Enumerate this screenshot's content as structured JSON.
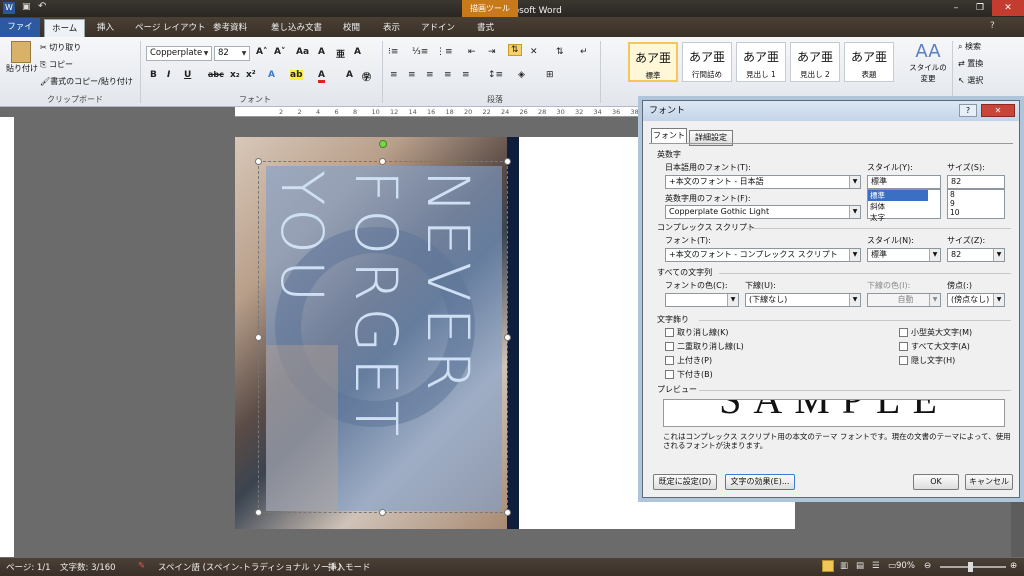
{
  "window": {
    "title": "文書1 - Microsoft Word",
    "context_tab": "描画ツール"
  },
  "tabs": [
    "ファイル",
    "ホーム",
    "挿入",
    "ページ レイアウト",
    "参考資料",
    "差し込み文書",
    "校閲",
    "表示",
    "アドイン",
    "書式"
  ],
  "clipboard": {
    "paste": "貼り付け",
    "cut": "切り取り",
    "copy": "コピー",
    "format_painter": "書式のコピー/貼り付け",
    "label": "クリップボード"
  },
  "font": {
    "name": "Copperplate",
    "size": "82",
    "label": "フォント"
  },
  "paragraph": {
    "label": "段落"
  },
  "styles": {
    "label": "スタイル",
    "items": [
      {
        "sample": "あア亜",
        "name": "標準"
      },
      {
        "sample": "あア亜",
        "name": "行間詰め"
      },
      {
        "sample": "あア亜",
        "name": "見出し 1"
      },
      {
        "sample": "あア亜",
        "name": "見出し 2"
      },
      {
        "sample": "あア亜",
        "name": "表題"
      }
    ],
    "change": "スタイルの変更",
    "editing_label": "編集",
    "search": "検索",
    "replace": "置換",
    "select": "選択"
  },
  "ruler": [
    "2",
    "2",
    "4",
    "6",
    "8",
    "10",
    "12",
    "14",
    "16",
    "18",
    "20",
    "22",
    "24",
    "26",
    "28",
    "30",
    "32",
    "34",
    "36",
    "38"
  ],
  "doc": {
    "text1": "NEVER",
    "text2": "FORGET",
    "text3": "YOU"
  },
  "dialog": {
    "title": "フォント",
    "tab_font": "フォント",
    "tab_advanced": "詳細設定",
    "latin_section": "英数字",
    "jp_font_label": "日本語用のフォント(T):",
    "jp_font_value": "+本文のフォント - 日本語",
    "latin_font_label": "英数字用のフォント(F):",
    "latin_font_value": "Copperplate Gothic Light",
    "style_label": "スタイル(Y):",
    "style_value": "標準",
    "style_options": [
      "標準",
      "斜体",
      "太字"
    ],
    "size_label": "サイズ(S):",
    "size_value": "82",
    "size_options": [
      "8",
      "9",
      "10"
    ],
    "complex_section": "コンプレックス スクリプト",
    "cs_font_label": "フォント(T):",
    "cs_font_value": "+本文のフォント - コンプレックス スクリプト",
    "cs_style_label": "スタイル(N):",
    "cs_style_value": "標準",
    "cs_size_label": "サイズ(Z):",
    "cs_size_value": "82",
    "all_section": "すべての文字列",
    "color_label": "フォントの色(C):",
    "color_value": "",
    "underline_label": "下線(U):",
    "underline_value": "(下線なし)",
    "underline_color_label": "下線の色(I):",
    "underline_color_value": "自動",
    "emphasis_label": "傍点(:)",
    "emphasis_value": "(傍点なし)",
    "effects_section": "文字飾り",
    "effects_left": [
      "取り消し線(K)",
      "二重取り消し線(L)",
      "上付き(P)",
      "下付き(B)"
    ],
    "effects_right": [
      "小型英大文字(M)",
      "すべて大文字(A)",
      "隠し文字(H)"
    ],
    "preview_section": "プレビュー",
    "preview_text": "SAMPLE",
    "preview_note": "これはコンプレックス スクリプト用の本文のテーマ フォントです。現在の文書のテーマによって、使用されるフォントが決まります。",
    "default_button": "既定に設定(D)",
    "effects_button": "文字の効果(E)...",
    "ok_button": "OK",
    "cancel_button": "キャンセル"
  },
  "status": {
    "page": "ページ: 1/1",
    "words": "文字数: 3/160",
    "language": "スペイン語 (スペイン-トラディショナル ソート)",
    "mode": "挿入モード",
    "zoom": "90%"
  }
}
